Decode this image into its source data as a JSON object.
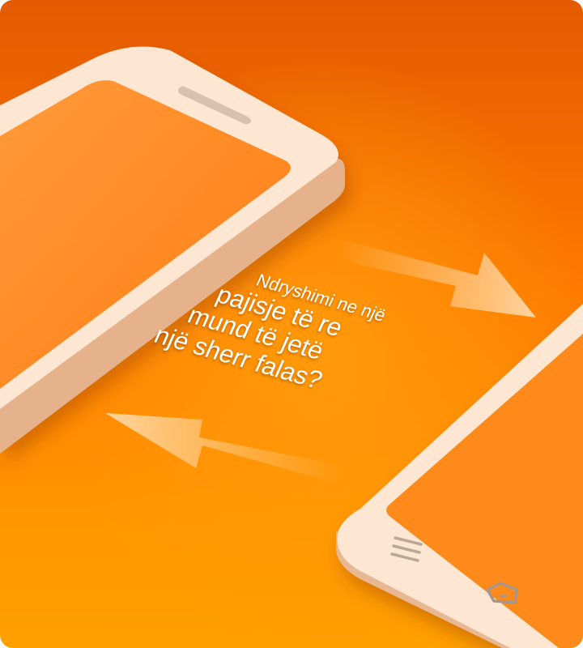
{
  "headline": {
    "line1": "Ndryshimi ne një",
    "line2": "pajisje të re",
    "line3": "mund të jetë",
    "line4": "një sherr falas?"
  },
  "icons": {
    "menu": "hamburger-menu-icon",
    "home": "home-icon",
    "arrows": [
      "arrow-right-icon",
      "arrow-left-icon"
    ]
  },
  "colors": {
    "background_top": "#e45a00",
    "background_bottom": "#ffa000",
    "phone_body": "#fde5cf",
    "phone_edge": "#e8b895",
    "screen": "#ff8a1e",
    "text": "#ffffff"
  }
}
